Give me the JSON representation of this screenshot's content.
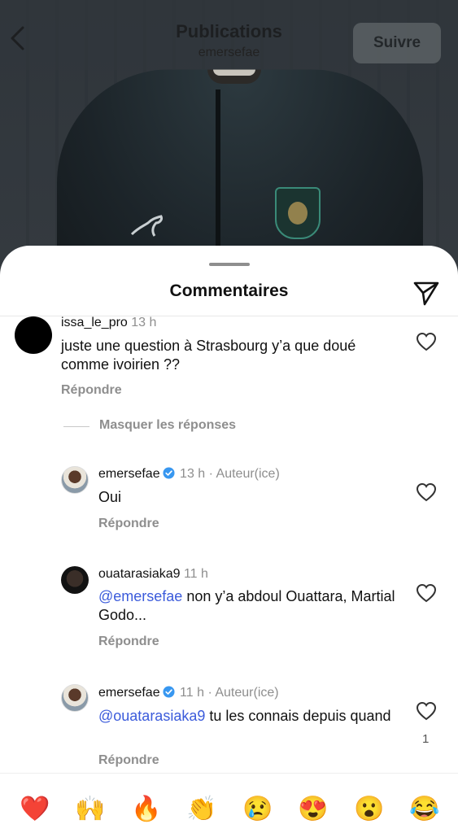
{
  "header": {
    "title": "Publications",
    "subtitle": "emersefae",
    "follow_label": "Suivre"
  },
  "sheet": {
    "title": "Commentaires"
  },
  "comments": [
    {
      "username": "issa_le_pro",
      "time": "13 h",
      "text": "juste une question à Strasbourg y’a que doué comme ivoirien ??",
      "reply_label": "Répondre"
    }
  ],
  "hide_replies_label": "Masquer les réponses",
  "replies": [
    {
      "username": "emersefae",
      "verified": true,
      "time": "13 h",
      "role": "Auteur(ice)",
      "text": "Oui",
      "reply_label": "Répondre"
    },
    {
      "username": "ouatarasiaka9",
      "verified": false,
      "time": "11 h",
      "mention": "@emersefae",
      "text": " non y’a abdoul Ouattara, Martial Godo...",
      "reply_label": "Répondre"
    },
    {
      "username": "emersefae",
      "verified": true,
      "time": "11 h",
      "role": "Auteur(ice)",
      "mention": "@ouatarasiaka9",
      "text": " tu les connais depuis quand",
      "reply_label": "Répondre",
      "likes": "1"
    }
  ],
  "emoji_bar": [
    "❤️",
    "🙌",
    "🔥",
    "👏",
    "😢",
    "😍",
    "😮",
    "😂"
  ],
  "colors": {
    "mention": "#3b5bdb",
    "verified": "#3897f0",
    "muted_text": "#8e8e8e"
  },
  "icons": {
    "back": "chevron-left-icon",
    "share": "paper-plane-icon",
    "like": "heart-outline-icon",
    "verified": "verified-badge-icon"
  }
}
